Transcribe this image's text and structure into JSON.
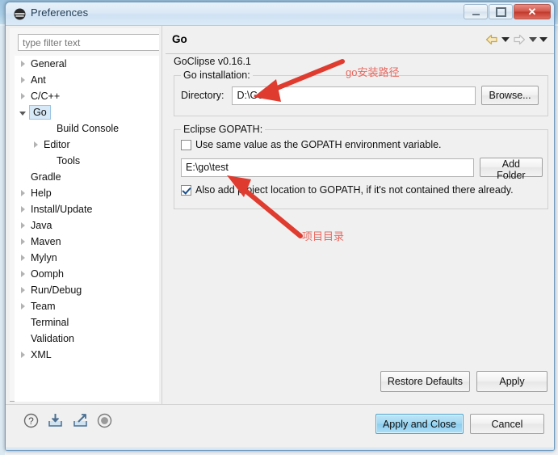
{
  "window": {
    "title": "Preferences",
    "icon": "eclipse-icon",
    "controls": {
      "minimize": "minimize-button",
      "maximize": "maximize-button",
      "close_glyph": "✕"
    }
  },
  "sidebar": {
    "filter": {
      "placeholder": "type filter text",
      "value": ""
    },
    "items": [
      {
        "label": "General",
        "indent": 0,
        "twisty": "closed",
        "selected": false
      },
      {
        "label": "Ant",
        "indent": 0,
        "twisty": "closed",
        "selected": false
      },
      {
        "label": "C/C++",
        "indent": 0,
        "twisty": "closed",
        "selected": false
      },
      {
        "label": "Go",
        "indent": 0,
        "twisty": "open",
        "selected": true
      },
      {
        "label": "Build Console",
        "indent": 2,
        "twisty": "none",
        "selected": false
      },
      {
        "label": "Editor",
        "indent": 1,
        "twisty": "closed",
        "selected": false
      },
      {
        "label": "Tools",
        "indent": 2,
        "twisty": "none",
        "selected": false
      },
      {
        "label": "Gradle",
        "indent": 0,
        "twisty": "none",
        "selected": false
      },
      {
        "label": "Help",
        "indent": 0,
        "twisty": "closed",
        "selected": false
      },
      {
        "label": "Install/Update",
        "indent": 0,
        "twisty": "closed",
        "selected": false
      },
      {
        "label": "Java",
        "indent": 0,
        "twisty": "closed",
        "selected": false
      },
      {
        "label": "Maven",
        "indent": 0,
        "twisty": "closed",
        "selected": false
      },
      {
        "label": "Mylyn",
        "indent": 0,
        "twisty": "closed",
        "selected": false
      },
      {
        "label": "Oomph",
        "indent": 0,
        "twisty": "closed",
        "selected": false
      },
      {
        "label": "Run/Debug",
        "indent": 0,
        "twisty": "closed",
        "selected": false
      },
      {
        "label": "Team",
        "indent": 0,
        "twisty": "closed",
        "selected": false
      },
      {
        "label": "Terminal",
        "indent": 0,
        "twisty": "none",
        "selected": false
      },
      {
        "label": "Validation",
        "indent": 0,
        "twisty": "none",
        "selected": false
      },
      {
        "label": "XML",
        "indent": 0,
        "twisty": "closed",
        "selected": false
      }
    ]
  },
  "page": {
    "title": "Go",
    "version_text": "GoClipse v0.16.1",
    "nav": {
      "back": "back-arrow-icon",
      "back_menu": "back-dropdown-icon",
      "forward": "forward-arrow-icon",
      "forward_menu": "forward-dropdown-icon",
      "view_menu": "view-menu-icon"
    },
    "go_installation": {
      "group_label": "Go installation:",
      "directory_label": "Directory:",
      "directory_value": "D:\\Go",
      "browse_label": "Browse..."
    },
    "eclipse_gopath": {
      "group_label": "Eclipse GOPATH:",
      "use_env_checkbox": {
        "label": "Use same value as the GOPATH environment variable.",
        "checked": false
      },
      "gopath_value": "E:\\go\\test",
      "add_folder_label": "Add Folder",
      "also_add_checkbox": {
        "label": "Also add project location to GOPATH, if it's not contained there already.",
        "checked": true
      }
    },
    "buttons": {
      "restore_defaults": "Restore Defaults",
      "apply": "Apply"
    }
  },
  "footer": {
    "icons": [
      {
        "name": "help-icon"
      },
      {
        "name": "import-icon"
      },
      {
        "name": "export-icon"
      },
      {
        "name": "record-icon"
      }
    ],
    "apply_and_close": "Apply and Close",
    "cancel": "Cancel"
  },
  "annotations": {
    "install_path": "go安装路径",
    "project_dir": "项目目录",
    "color": "#e8685f"
  }
}
